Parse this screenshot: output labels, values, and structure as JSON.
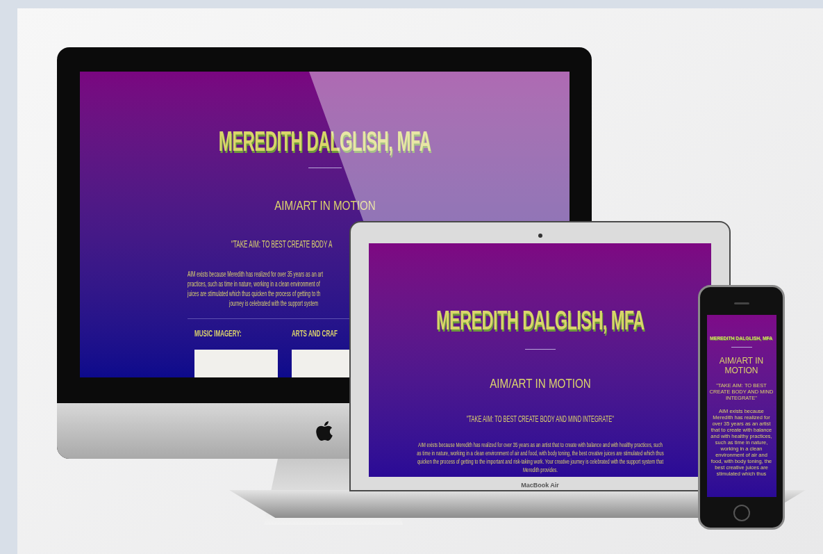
{
  "monitor": {
    "title": "MEREDITH DALGLISH, MFA",
    "subtitle": "AIM/ART IN MOTION",
    "quote": "\"TAKE AIM:  TO BEST CREATE BODY A",
    "paragraph_lines": [
      "AIM exists because Meredith has realized for over 35 years as an art",
      "practices, such as time in nature, working in a clean environment of",
      "juices are stimulated which thus quicken the process of getting to th",
      "journey is celebrated with the support system"
    ],
    "sections": [
      "MUSIC IMAGERY:",
      "ARTS AND CRAF"
    ]
  },
  "laptop": {
    "title": "MEREDITH DALGLISH, MFA",
    "subtitle": "AIM/ART IN MOTION",
    "quote": "\"TAKE AIM:  TO BEST CREATE BODY AND MIND INTEGRATE\"",
    "paragraph": "AIM exists because Meredith has realized for over 35 years as an artist that to create with balance and with healthy practices, such as time in nature, working in a clean environment of air and food, with body toning, the best creative juices are stimulated which thus quicken the process of getting to the important and risk-taking work. Your creative journey is celebrated with the support system that Meredith provides.",
    "label": "MacBook Air"
  },
  "phone": {
    "title": "MEREDITH DALGLISH, MFA",
    "subtitle": "AIM/ART IN MOTION",
    "quote": "\"TAKE AIM: TO BEST CREATE BODY AND MIND INTEGRATE\"",
    "paragraph": "AIM exists because Meredith has realized for over 35 years as an artist that to create with balance and with healthy practices, such as time in nature, working in a clean environment of air and food, with body toning, the best creative juices are stimulated which thus"
  }
}
